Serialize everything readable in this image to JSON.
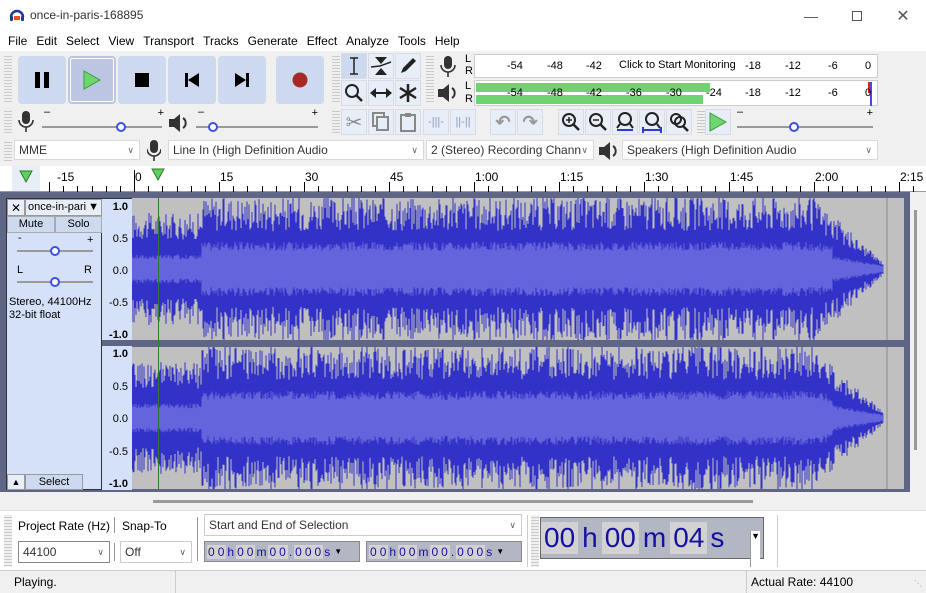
{
  "window": {
    "title": "once-in-paris-168895",
    "controls": [
      "minimize",
      "maximize",
      "close"
    ]
  },
  "menu": [
    "File",
    "Edit",
    "Select",
    "View",
    "Transport",
    "Tracks",
    "Generate",
    "Effect",
    "Analyze",
    "Tools",
    "Help"
  ],
  "transport": {
    "buttons": [
      {
        "name": "pause",
        "icon": "pause-icon"
      },
      {
        "name": "play",
        "icon": "play-icon",
        "active": true
      },
      {
        "name": "stop",
        "icon": "stop-icon"
      },
      {
        "name": "skip-to-start",
        "icon": "skip-start-icon"
      },
      {
        "name": "skip-to-end",
        "icon": "skip-end-icon"
      },
      {
        "name": "record",
        "icon": "record-icon"
      }
    ]
  },
  "tools": [
    "selection-tool",
    "envelope-tool",
    "draw-tool",
    "zoom-tool",
    "time-shift-tool",
    "multi-tool"
  ],
  "meters": {
    "record": {
      "tick_labels": [
        "-54",
        "-48",
        "-42",
        "-18",
        "-12",
        "-6",
        "0"
      ],
      "prompt": "Click to Start Monitoring",
      "channels": [
        "L",
        "R"
      ]
    },
    "playback": {
      "tick_labels": [
        "-54",
        "-48",
        "-42",
        "-36",
        "-30",
        "-24",
        "-18",
        "-12",
        "-6",
        "0"
      ],
      "channels": [
        "L",
        "R"
      ],
      "level_db_L": -23,
      "level_db_R": -24
    }
  },
  "mixer": {
    "record_volume": 0.67,
    "playback_volume": 0.1
  },
  "edit_toolbar": [
    "cut",
    "copy",
    "paste",
    "trim-audio",
    "silence-audio",
    "undo",
    "redo",
    "zoom-in",
    "zoom-out",
    "fit-selection",
    "fit-project",
    "zoom-toggle"
  ],
  "play_at_speed": {
    "value": 0.4
  },
  "devices": {
    "host": "MME",
    "input": "Line In (High Definition Audio",
    "channels": "2 (Stereo) Recording Chann",
    "output": "Speakers (High Definition Audio"
  },
  "ruler": {
    "labels": [
      "-15",
      "0",
      "15",
      "30",
      "45",
      "1:00",
      "1:15",
      "1:30",
      "1:45",
      "2:00",
      "2:15"
    ]
  },
  "track": {
    "name": "once-in-pari",
    "mute": "Mute",
    "solo": "Solo",
    "gain_minus": "-",
    "gain_plus": "+",
    "pan_l": "L",
    "pan_r": "R",
    "info1": "Stereo, 44100Hz",
    "info2": "32-bit float",
    "select": "Select",
    "scale": [
      "1.0",
      "0.5",
      "0.0",
      "-0.5",
      "-1.0"
    ]
  },
  "selection_bar": {
    "project_rate_label": "Project Rate (Hz)",
    "snap_label": "Snap-To",
    "project_rate": "44100",
    "snap": "Off",
    "selection_mode": "Start and End of Selection",
    "start": [
      "0",
      "0",
      "h",
      "0",
      "0",
      "m",
      "0",
      "0",
      ".",
      "0",
      "0",
      "0",
      "s"
    ],
    "end": [
      "0",
      "0",
      "h",
      "0",
      "0",
      "m",
      "0",
      "0",
      ".",
      "0",
      "0",
      "0",
      "s"
    ]
  },
  "time_display": {
    "h": "00",
    "h_unit": "h",
    "m": "00",
    "m_unit": "m",
    "s": "04",
    "s_unit": "s"
  },
  "status": {
    "text": "Playing.",
    "rate": "Actual Rate: 44100"
  }
}
